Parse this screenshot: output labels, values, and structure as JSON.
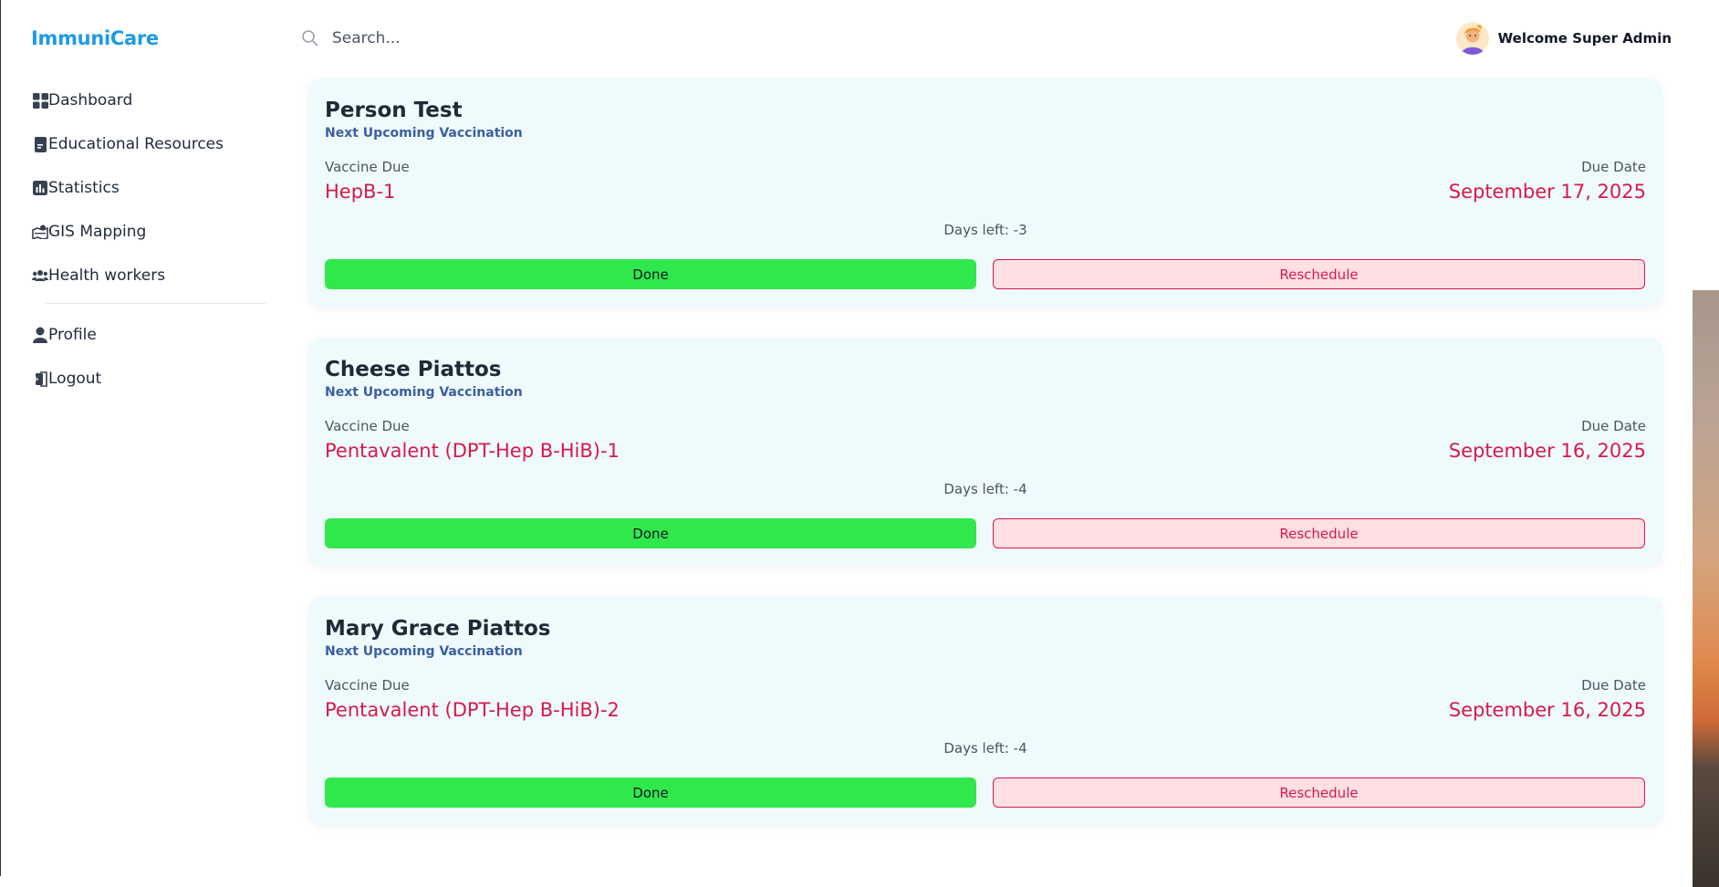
{
  "app": {
    "brand": "ImmuniCare"
  },
  "sidebar": {
    "items": [
      {
        "label": "Dashboard",
        "icon": "dashboard-grid-icon"
      },
      {
        "label": "Educational Resources",
        "icon": "book-icon"
      },
      {
        "label": "Statistics",
        "icon": "bar-chart-icon"
      },
      {
        "label": "GIS Mapping",
        "icon": "map-icon"
      },
      {
        "label": "Health workers",
        "icon": "users-icon"
      }
    ],
    "bottom_items": [
      {
        "label": "Profile",
        "icon": "user-icon"
      },
      {
        "label": "Logout",
        "icon": "logout-icon"
      }
    ]
  },
  "header": {
    "search_placeholder": "Search...",
    "search_value": "",
    "welcome": "Welcome Super Admin"
  },
  "cards": [
    {
      "name": "Person Test",
      "subtitle": "Next Upcoming Vaccination",
      "vaccine_label": "Vaccine Due",
      "vaccine": "HepB-1",
      "due_label": "Due Date",
      "due_date": "September 17, 2025",
      "days_left": "Days left: -3",
      "done_label": "Done",
      "reschedule_label": "Reschedule"
    },
    {
      "name": "Cheese Piattos",
      "subtitle": "Next Upcoming Vaccination",
      "vaccine_label": "Vaccine Due",
      "vaccine": "Pentavalent (DPT-Hep B-HiB)-1",
      "due_label": "Due Date",
      "due_date": "September 16, 2025",
      "days_left": "Days left: -4",
      "done_label": "Done",
      "reschedule_label": "Reschedule"
    },
    {
      "name": "Mary Grace Piattos",
      "subtitle": "Next Upcoming Vaccination",
      "vaccine_label": "Vaccine Due",
      "vaccine": "Pentavalent (DPT-Hep B-HiB)-2",
      "due_label": "Due Date",
      "due_date": "September 16, 2025",
      "days_left": "Days left: -4",
      "done_label": "Done",
      "reschedule_label": "Reschedule"
    }
  ],
  "colors": {
    "brand": "#1e9be6",
    "card_bg": "#effafd",
    "accent_red": "#d7194a",
    "done_green": "#31e84c",
    "subtitle_blue": "#3b5fa0"
  }
}
